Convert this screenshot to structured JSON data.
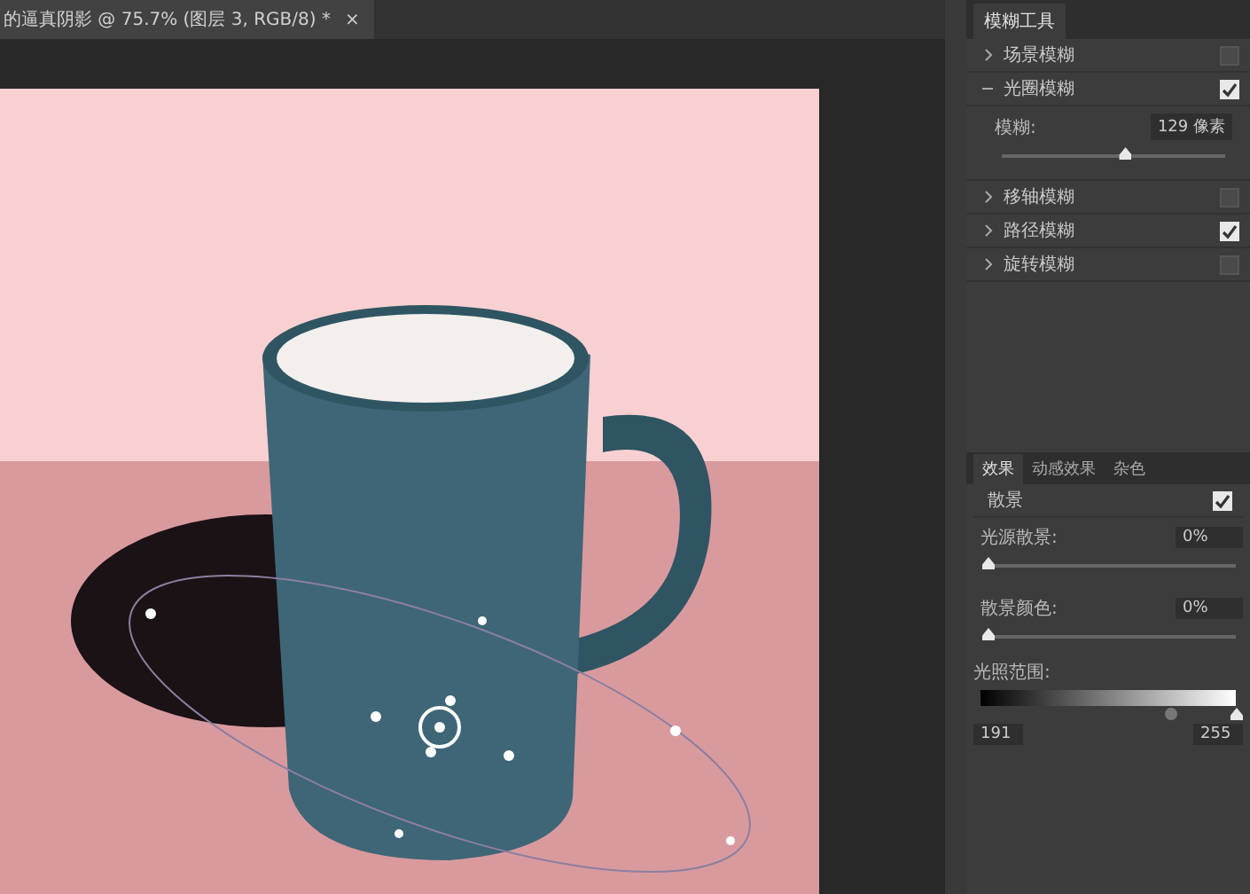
{
  "document_tab": {
    "title": "的逼真阴影 @ 75.7% (图层 3, RGB/8) *",
    "close": "×"
  },
  "blur_tools": {
    "title": "模糊工具",
    "items": [
      {
        "label": "场景模糊",
        "expanded": false,
        "checked": false
      },
      {
        "label": "光圈模糊",
        "expanded": true,
        "checked": true,
        "setting": {
          "label": "模糊:",
          "value": "129 像素",
          "level": 0.55
        }
      },
      {
        "label": "移轴模糊",
        "expanded": false,
        "checked": false
      },
      {
        "label": "路径模糊",
        "expanded": false,
        "checked": true
      },
      {
        "label": "旋转模糊",
        "expanded": false,
        "checked": false
      }
    ]
  },
  "effects": {
    "tabs": [
      {
        "label": "效果",
        "selected": true
      },
      {
        "label": "动感效果",
        "selected": false
      },
      {
        "label": "杂色",
        "selected": false
      }
    ],
    "bokeh": {
      "label": "散景",
      "checked": true
    },
    "sliders": [
      {
        "label": "光源散景:",
        "value": "0%",
        "level": 0
      },
      {
        "label": "散景颜色:",
        "value": "0%",
        "level": 0
      }
    ],
    "light_range": {
      "label": "光照范围:",
      "handles": [
        {
          "level": 0.75
        },
        {
          "level": 1
        }
      ],
      "low": "191",
      "high": "255"
    }
  }
}
